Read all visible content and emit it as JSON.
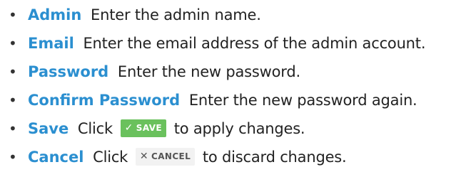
{
  "items": [
    {
      "name": "Admin",
      "desc": "Enter the admin name."
    },
    {
      "name": "Email",
      "desc": "Enter the email address of the admin account."
    },
    {
      "name": "Password",
      "desc": "Enter the new password."
    },
    {
      "name": "Confirm Password",
      "desc": "Enter the new password again."
    },
    {
      "name": "Save",
      "desc_before": "Click",
      "desc_after": "to apply changes."
    },
    {
      "name": "Cancel",
      "desc_before": "Click",
      "desc_after": "to discard changes."
    }
  ],
  "buttons": {
    "save": {
      "label": "SAVE",
      "icon": "check-icon",
      "color": "#6ac15d"
    },
    "cancel": {
      "label": "CANCEL",
      "icon": "close-icon",
      "color": "#f2f2f2"
    }
  },
  "colors": {
    "field_name": "#2b8fd0",
    "text": "#222222"
  }
}
